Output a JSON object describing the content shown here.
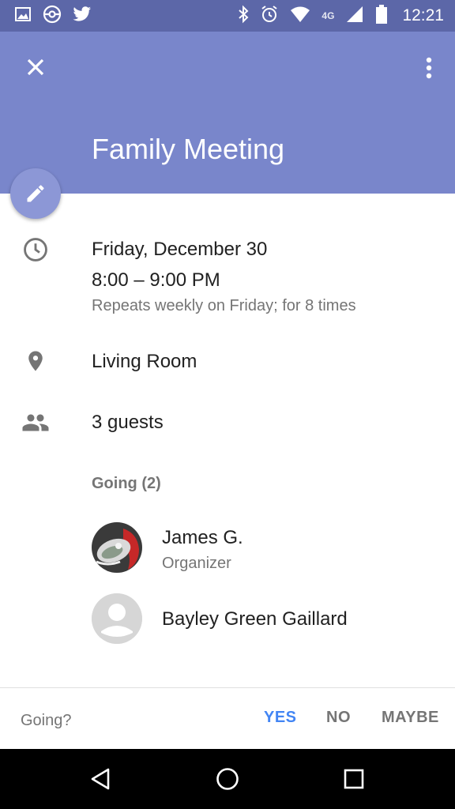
{
  "status_bar": {
    "time": "12:21",
    "network": "4G",
    "icons": [
      "gallery-icon",
      "pokeball-icon",
      "twitter-icon",
      "bluetooth-icon",
      "alarm-icon",
      "wifi-icon",
      "signal-icon",
      "battery-icon"
    ]
  },
  "app_bar": {
    "title": "Family Meeting",
    "color": "#7986cb",
    "close_icon": "close-icon",
    "more_icon": "more-vert-icon"
  },
  "fab": {
    "icon": "edit-icon"
  },
  "event": {
    "date": "Friday, December 30",
    "time_range": "8:00 – 9:00 PM",
    "recurrence": "Repeats weekly on Friday; for 8 times",
    "location": "Living Room",
    "guests_count": "3 guests"
  },
  "guests": {
    "going_label": "Going (2)",
    "list": [
      {
        "name": "James G.",
        "role": "Organizer"
      },
      {
        "name": "Bayley Green Gaillard",
        "role": ""
      }
    ]
  },
  "rsvp": {
    "question": "Going?",
    "yes": "YES",
    "no": "NO",
    "maybe": "MAYBE",
    "accent": "#4285f4"
  },
  "nav": {
    "icons": [
      "back-icon",
      "home-icon",
      "recents-icon"
    ]
  }
}
